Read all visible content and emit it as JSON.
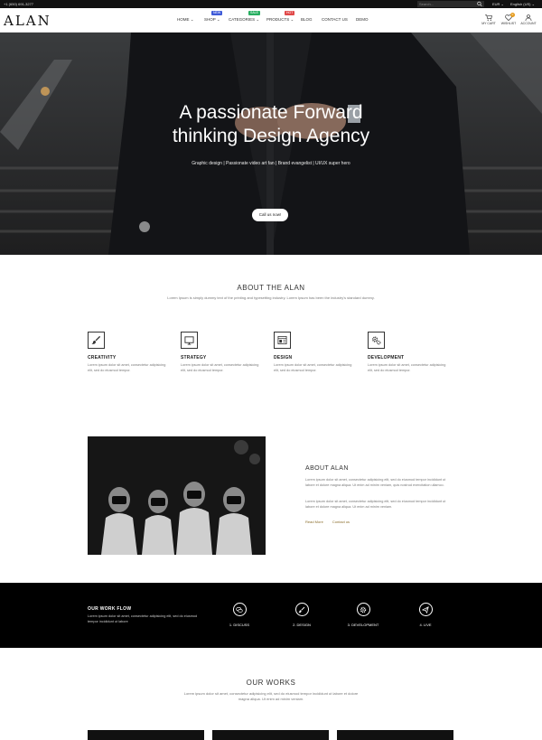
{
  "topbar": {
    "phone": "+1 (650) 691-3277",
    "search_placeholder": "Search...",
    "currency": "EUR ⌄",
    "language": "English (US) ⌄"
  },
  "header": {
    "logo": "ALAN",
    "nav": [
      {
        "label": "HOME ⌄",
        "badge": ""
      },
      {
        "label": "SHOP ⌄",
        "badge": "NEW",
        "badge_color": "#3f5bd8"
      },
      {
        "label": "CATEGORIES ⌄",
        "badge": "SALE",
        "badge_color": "#27ae60"
      },
      {
        "label": "PRODUCTS ⌄",
        "badge": "HOT",
        "badge_color": "#e04848"
      },
      {
        "label": "BLOG",
        "badge": ""
      },
      {
        "label": "CONTACT US",
        "badge": ""
      },
      {
        "label": "DEMO",
        "badge": ""
      }
    ],
    "icons": [
      {
        "label": "MY CART",
        "icon": "cart-icon"
      },
      {
        "label": "WISHLIST",
        "icon": "heart-icon",
        "count": "0"
      },
      {
        "label": "ACCOUNT",
        "icon": "user-icon"
      }
    ]
  },
  "hero": {
    "title_line1": "A passionate Forward",
    "title_line2": "thinking Design Agency",
    "subtitle": "Graphic design | Passionate video art fan | Brand evangelist | UI/UX super hero",
    "button": "Call us now!"
  },
  "about": {
    "title": "ABOUT THE ALAN",
    "desc": "Lorem Ipsum is simply dummy text of the printing and typesetting industry. Lorem Ipsum has been the industry's standard dummy.",
    "features": [
      {
        "name": "CREATIVITY",
        "icon": "brush-icon",
        "desc": "Lorem ipsum dolor sit amet, consectetur adipisicing elit, sed do eiusmod tempor."
      },
      {
        "name": "STRATEGY",
        "icon": "monitor-icon",
        "desc": "Lorem ipsum dolor sit amet, consectetur adipisicing elit, sed do eiusmod tempor."
      },
      {
        "name": "DESIGN",
        "icon": "layout-icon",
        "desc": "Lorem ipsum dolor sit amet, consectetur adipisicing elit, sed do eiusmod tempor."
      },
      {
        "name": "DEVELOPMENT",
        "icon": "gears-icon",
        "desc": "Lorem ipsum dolor sit amet, consectetur adipisicing elit, sed do eiusmod tempor."
      }
    ]
  },
  "about2": {
    "title": "ABOUT ALAN",
    "p1": "Lorem ipsum dolor sit amet, consectetur adipisicing elit, sed do eiusmod tempor incididunt ut labore et dolore magna aliqua. Ut enim ad minim veniam, quis nostrud exercitation ullamco.",
    "p2": "Lorem ipsum dolor sit amet, consectetur adipisicing elit, sed do eiusmod tempor incididunt ut labore et dolore magna aliqua. Ut enim ad minim veniam.",
    "link1": "Read More",
    "link2": "Contact us"
  },
  "workflow": {
    "title": "OUR WORK FLOW",
    "desc": "Lorem ipsum dolor sit amet, consectetur adipisicing elit, sed do eiusmod tempor incididunt ut labore",
    "steps": [
      {
        "label": "1. DISCUSS",
        "icon": "chat-icon"
      },
      {
        "label": "2. DESIGN",
        "icon": "brush-icon"
      },
      {
        "label": "3. DEVELOPMENT",
        "icon": "gear-icon"
      },
      {
        "label": "4. LIVE",
        "icon": "paper-plane-icon"
      }
    ]
  },
  "works": {
    "title": "OUR WORKS",
    "desc": "Lorem ipsum dolor sit amet, consectetur adipisicing elit, sed do eiusmod tempor incididunt ut labore et dolore magna aliqua. Ut enim ad minim veniam."
  }
}
